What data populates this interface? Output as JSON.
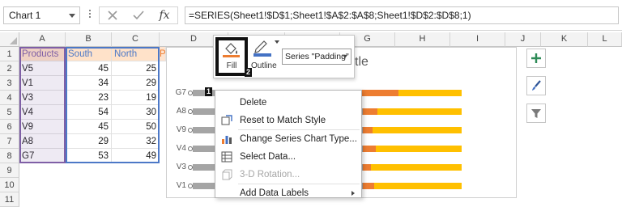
{
  "formula_bar": {
    "name_box": "Chart 1",
    "cancel_icon": "x-icon",
    "enter_icon": "check-icon",
    "function_label": "fx",
    "formula": "=SERIES(Sheet1!$D$1;Sheet1!$A$2:$A$8;Sheet1!$D$2:$D$8;1)"
  },
  "columns": [
    "A",
    "B",
    "C",
    "D",
    "E",
    "F",
    "G",
    "H",
    "I",
    "J",
    "K",
    "L"
  ],
  "rows": [
    "1",
    "2",
    "3",
    "4",
    "5",
    "6",
    "7",
    "8",
    "9",
    "10",
    "11"
  ],
  "table": {
    "headers": [
      "Products",
      "South",
      "North",
      "P"
    ],
    "rows": [
      [
        "V5",
        "45",
        "25"
      ],
      [
        "V1",
        "34",
        "29"
      ],
      [
        "V3",
        "23",
        "19"
      ],
      [
        "V4",
        "54",
        "30"
      ],
      [
        "V9",
        "45",
        "50"
      ],
      [
        "A8",
        "29",
        "32"
      ],
      [
        "G7",
        "53",
        "49"
      ]
    ]
  },
  "chart": {
    "title_partial": "tle",
    "categories": [
      "G7",
      "A8",
      "V9",
      "V4",
      "V3",
      "V1"
    ],
    "colors": {
      "gray": "#a5a5a5",
      "blue": "#4472c4",
      "orange": "#ed7d31",
      "yellow": "#ffc000"
    }
  },
  "chart_data": {
    "type": "bar",
    "categories": [
      "G7",
      "A8",
      "V9",
      "V4",
      "V3",
      "V1"
    ]
  },
  "mini_toolbar": {
    "fill_label": "Fill",
    "outline_label": "Outline",
    "series_selector": "Series \"Padding\"",
    "badge_1": "2"
  },
  "context_menu": {
    "badge": "1",
    "items": [
      {
        "label": "Delete",
        "icon": "none",
        "disabled": false
      },
      {
        "label": "Reset to Match Style",
        "icon": "reset-style-icon",
        "disabled": false
      },
      {
        "label": "Change Series Chart Type...",
        "icon": "chart-type-icon",
        "disabled": false
      },
      {
        "label": "Select Data...",
        "icon": "select-data-icon",
        "disabled": false
      },
      {
        "label": "3-D Rotation...",
        "icon": "rotation-3d-icon",
        "disabled": true
      },
      {
        "label": "Add Data Labels",
        "icon": "none",
        "disabled": false,
        "submenu": true
      }
    ]
  },
  "side_buttons": [
    "chart-elements-plus-icon",
    "chart-styles-brush-icon",
    "chart-filters-funnel-icon"
  ]
}
